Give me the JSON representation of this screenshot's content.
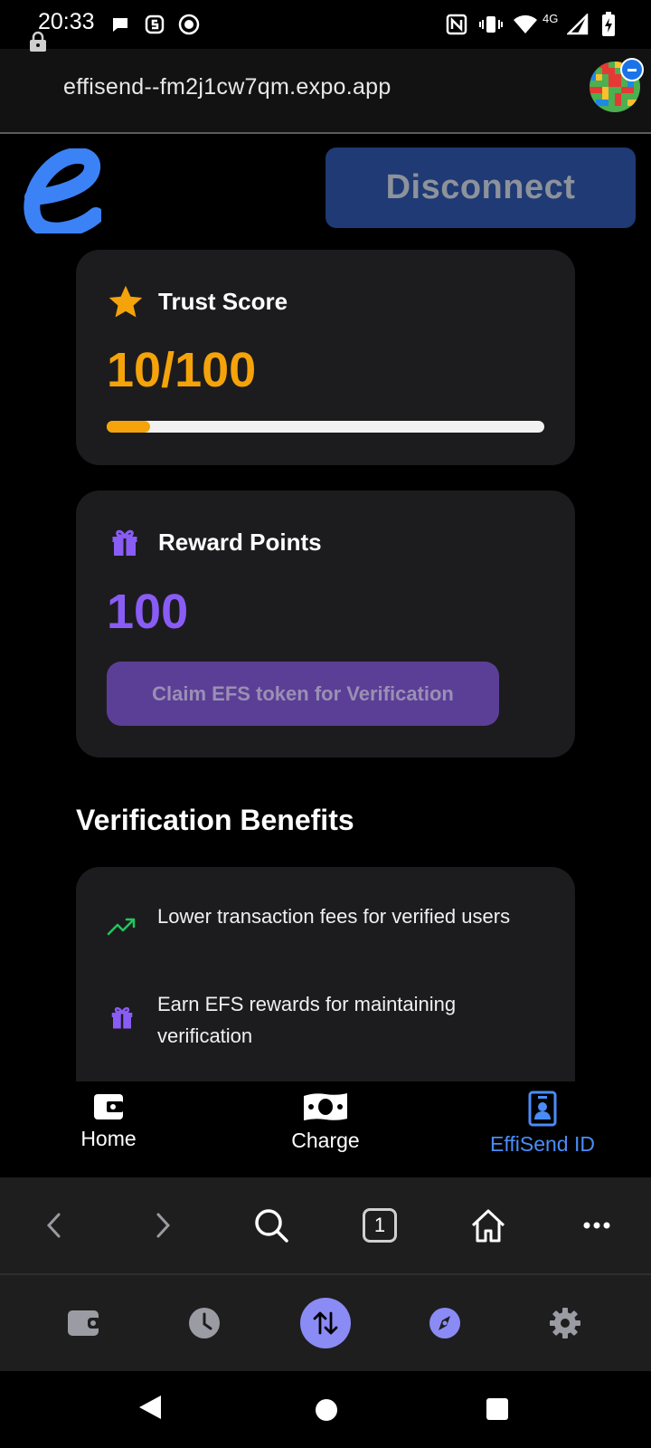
{
  "status_bar": {
    "time": "20:33",
    "network": "4G"
  },
  "browser": {
    "url": "effisend--fm2j1cw7qm.expo.app",
    "tab_count": "1"
  },
  "header": {
    "disconnect_label": "Disconnect"
  },
  "trust_score": {
    "title": "Trust Score",
    "value": "10/100",
    "progress_fraction": 0.1
  },
  "reward_points": {
    "title": "Reward Points",
    "value": "100",
    "claim_label": "Claim EFS token for Verification"
  },
  "benefits": {
    "title": "Verification Benefits",
    "items": [
      {
        "icon": "trending-up-icon",
        "text": "Lower transaction fees for verified users"
      },
      {
        "icon": "gift-icon",
        "text": "Earn EFS rewards for maintaining verification"
      }
    ]
  },
  "app_tabs": [
    {
      "label": "Home",
      "icon": "wallet-icon",
      "active": false
    },
    {
      "label": "Charge",
      "icon": "cash-icon",
      "active": false
    },
    {
      "label": "EffiSend ID",
      "icon": "id-badge-icon",
      "active": true
    }
  ],
  "colors": {
    "accent_orange": "#f5a30a",
    "accent_purple": "#8a5cf6",
    "active_tab": "#4a8cf7",
    "card_bg": "#1c1c1e"
  }
}
